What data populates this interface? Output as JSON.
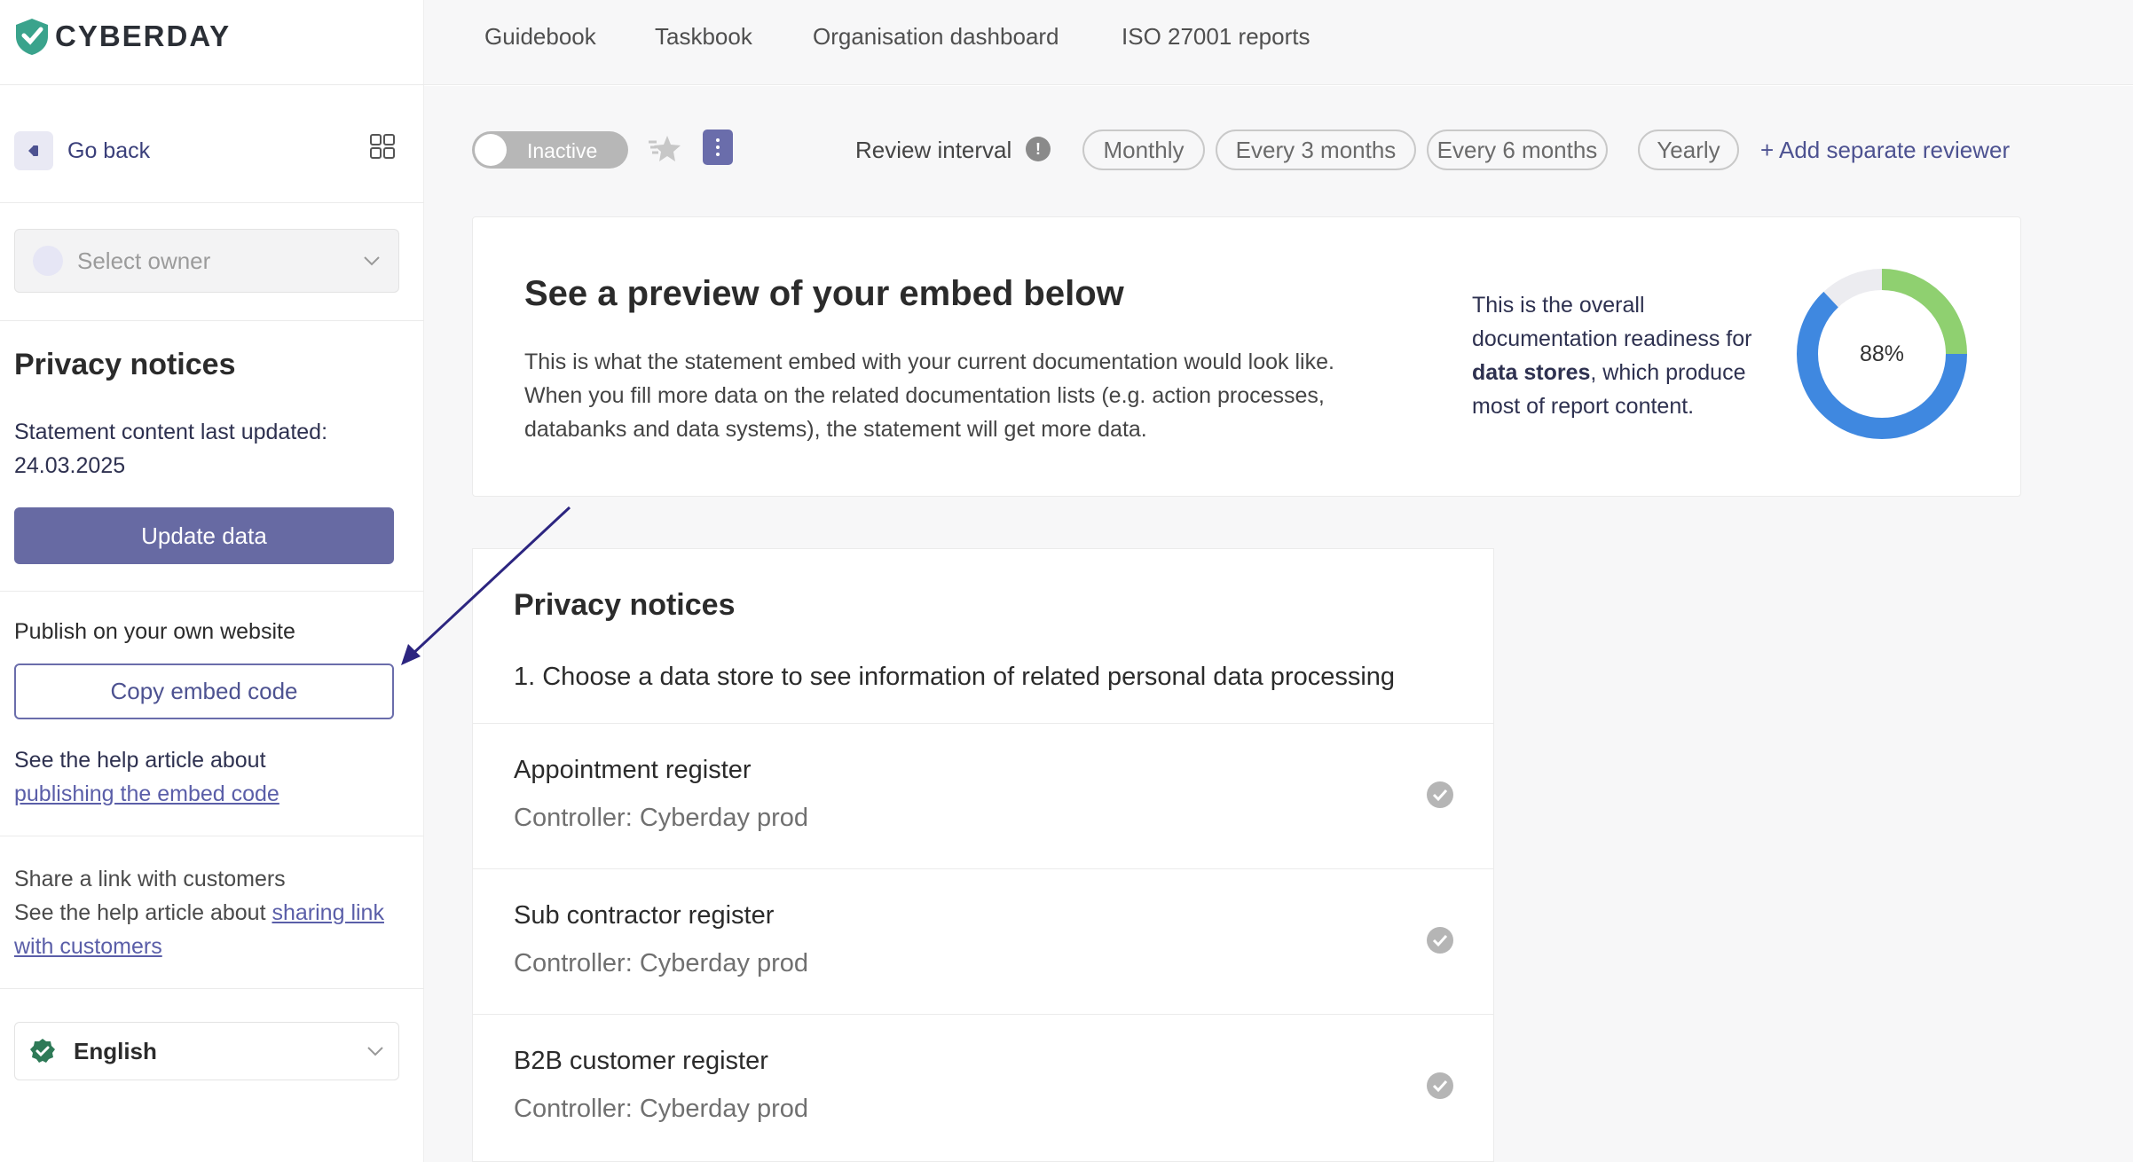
{
  "brand": {
    "name": "CYBERDAY",
    "primary": "#676aa3",
    "accent_green": "#8fd070",
    "accent_blue": "#3f88e0"
  },
  "topnav": {
    "items": [
      "Guidebook",
      "Taskbook",
      "Organisation dashboard",
      "ISO 27001 reports"
    ]
  },
  "sidebar": {
    "go_back": "Go back",
    "owner_placeholder": "Select owner",
    "section_title": "Privacy notices",
    "updated_label": "Statement content last updated:",
    "updated_date": "24.03.2025",
    "update_button": "Update data",
    "publish_label": "Publish on your own website",
    "copy_button": "Copy embed code",
    "help_text": "See the help article about",
    "help_link": "publishing the embed code",
    "share_label": "Share a link with customers",
    "share_help_text": "See the help article about",
    "share_link": "sharing link with customers",
    "language": "English"
  },
  "toolbar": {
    "status": "Inactive",
    "review_label": "Review interval",
    "intervals": [
      "Monthly",
      "Every 3 months",
      "Every 6 months",
      "Yearly"
    ],
    "add_reviewer": "+ Add separate reviewer"
  },
  "preview": {
    "title": "See a preview of your embed below",
    "body_lines": [
      "This is what the statement embed with your current documentation would look like.",
      "When you fill more data on the related documentation lists (e.g. action processes,",
      "databanks and data systems), the statement will get more data."
    ],
    "readiness_pre": "This is the overall documentation readiness for",
    "readiness_bold": "data stores",
    "readiness_post": ", which produce most of report content.",
    "readiness_percent": 88,
    "readiness_label": "88%"
  },
  "embed": {
    "title": "Privacy notices",
    "instruction": "1. Choose a data store to see information of related personal data processing",
    "registers": [
      {
        "name": "Appointment register",
        "controller": "Controller: Cyberday prod"
      },
      {
        "name": "Sub contractor register",
        "controller": "Controller: Cyberday prod"
      },
      {
        "name": "B2B customer register",
        "controller": "Controller: Cyberday prod"
      }
    ]
  }
}
